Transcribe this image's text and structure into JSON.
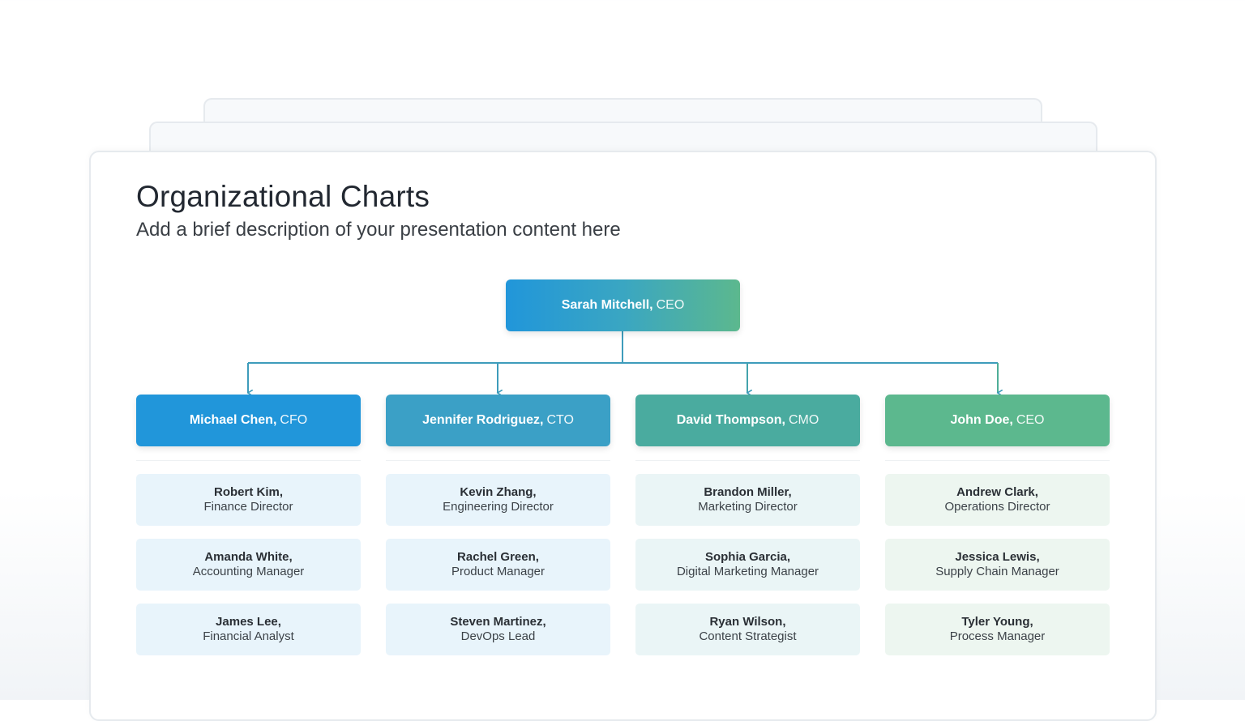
{
  "title": "Organizational Charts",
  "subtitle": "Add a brief description of your presentation content here",
  "colors": {
    "ceo_gradient_start": "#2196da",
    "ceo_gradient_end": "#5cb88e",
    "connector": "#3e9cbb",
    "sub_bg_blue": "#e8f4fb",
    "sub_bg_green": "#edf6f0"
  },
  "ceo": {
    "name": "Sarah Mitchell,",
    "role": "CEO"
  },
  "executives": [
    {
      "name": "Michael Chen,",
      "role": "CFO",
      "color": "#2196da",
      "reports": [
        {
          "name": "Robert Kim,",
          "role": "Finance Director"
        },
        {
          "name": "Amanda White,",
          "role": "Accounting Manager"
        },
        {
          "name": "James Lee,",
          "role": "Financial Analyst"
        }
      ]
    },
    {
      "name": "Jennifer Rodriguez,",
      "role": "CTO",
      "color": "#3ba0c6",
      "reports": [
        {
          "name": "Kevin Zhang,",
          "role": "Engineering Director"
        },
        {
          "name": "Rachel Green,",
          "role": "Product Manager"
        },
        {
          "name": "Steven Martinez,",
          "role": "DevOps Lead"
        }
      ]
    },
    {
      "name": "David Thompson,",
      "role": "CMO",
      "color": "#4aab9f",
      "reports": [
        {
          "name": "Brandon Miller,",
          "role": "Marketing Director"
        },
        {
          "name": "Sophia Garcia,",
          "role": "Digital Marketing Manager"
        },
        {
          "name": "Ryan Wilson,",
          "role": "Content Strategist"
        }
      ]
    },
    {
      "name": "John Doe,",
      "role": "CEO",
      "color": "#5cb88e",
      "reports": [
        {
          "name": "Andrew Clark,",
          "role": "Operations Director"
        },
        {
          "name": "Jessica Lewis,",
          "role": "Supply Chain Manager"
        },
        {
          "name": "Tyler Young,",
          "role": "Process Manager"
        }
      ]
    }
  ]
}
